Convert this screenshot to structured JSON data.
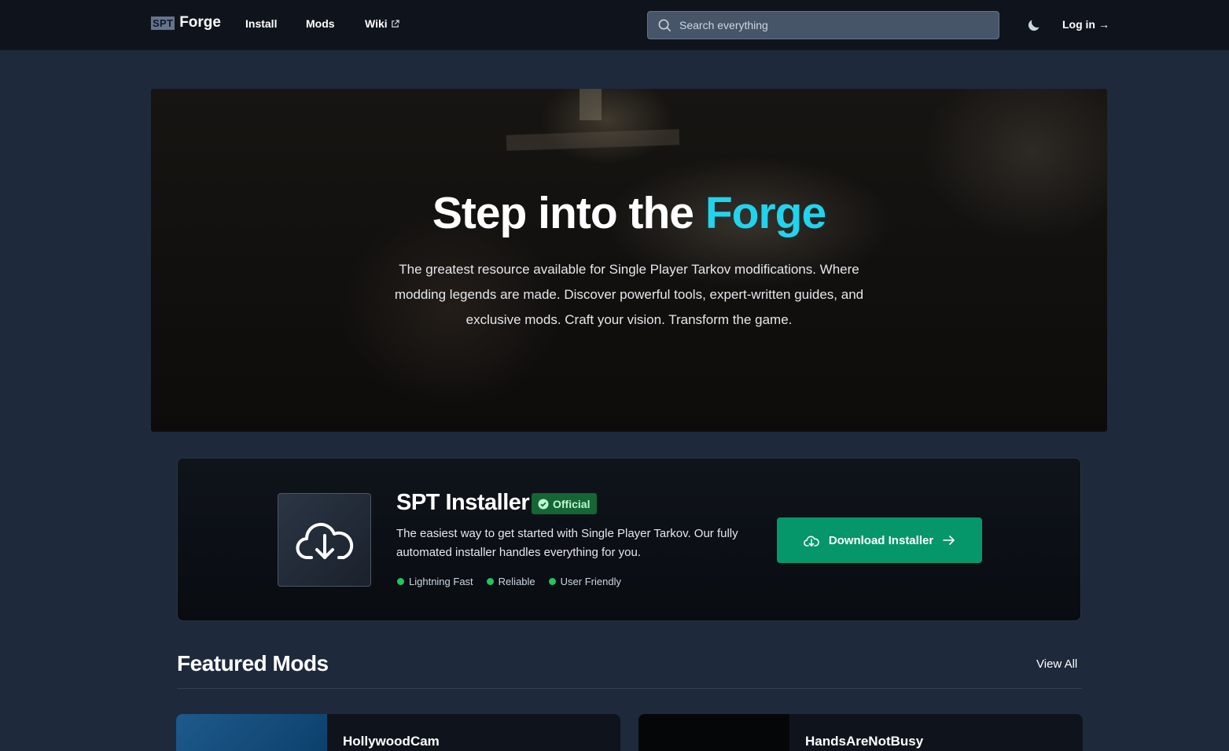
{
  "header": {
    "brand_badge": "SPT",
    "brand_name": "Forge",
    "nav": {
      "install": "Install",
      "mods": "Mods",
      "wiki": "Wiki"
    },
    "search_placeholder": "Search everything",
    "login": "Log in",
    "login_arrow": "→"
  },
  "hero": {
    "title_main": "Step into the ",
    "title_accent": "Forge",
    "description": "The greatest resource available for Single Player Tarkov modifications. Where modding legends are made. Discover powerful tools, expert-written guides, and exclusive mods. Craft your vision. Transform the game."
  },
  "installer": {
    "title": "SPT Installer",
    "badge": "Official",
    "description": "The easiest way to get started with Single Player Tarkov. Our fully automated installer handles everything for you.",
    "features": [
      "Lightning Fast",
      "Reliable",
      "User Friendly"
    ],
    "button": "Download Installer"
  },
  "featured": {
    "title": "Featured Mods",
    "view_all": "View All",
    "mods": [
      {
        "name": "HollywoodCam"
      },
      {
        "name": "HandsAreNotBusy"
      }
    ]
  },
  "colors": {
    "accent": "#22d3ee",
    "success": "#059669",
    "background": "#1e293b"
  }
}
